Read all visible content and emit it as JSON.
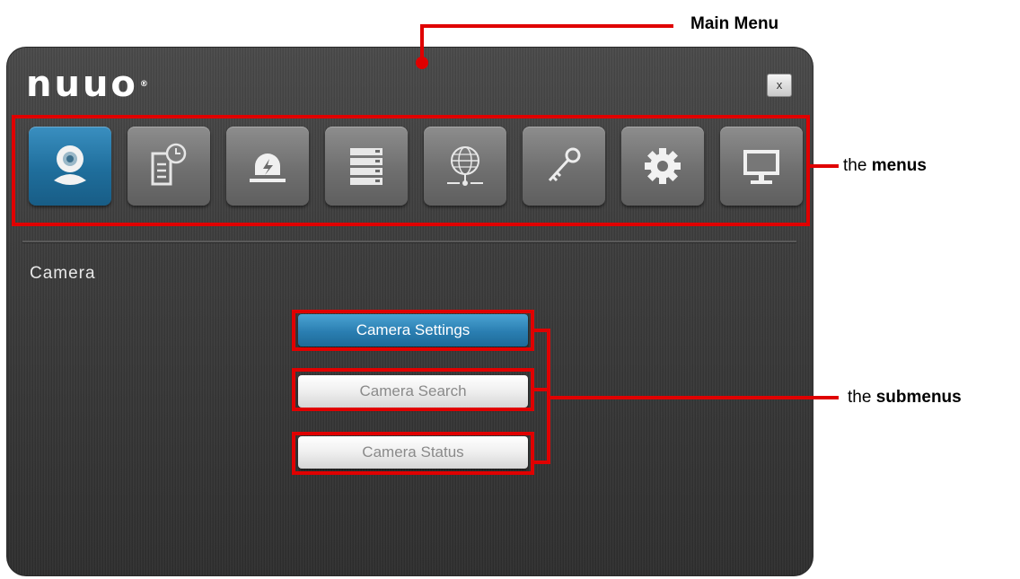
{
  "window": {
    "logo_text": "nuuo",
    "logo_mark": "®",
    "close_label": "x"
  },
  "menus": [
    {
      "name": "camera",
      "icon": "camera-icon",
      "active": true
    },
    {
      "name": "schedule",
      "icon": "schedule-document-icon",
      "active": false
    },
    {
      "name": "event",
      "icon": "alarm-siren-icon",
      "active": false
    },
    {
      "name": "storage",
      "icon": "storage-server-icon",
      "active": false
    },
    {
      "name": "network",
      "icon": "network-globe-icon",
      "active": false
    },
    {
      "name": "security",
      "icon": "key-icon",
      "active": false
    },
    {
      "name": "system",
      "icon": "gear-icon",
      "active": false
    },
    {
      "name": "display",
      "icon": "monitor-icon",
      "active": false
    }
  ],
  "section_title": "Camera",
  "submenus": [
    {
      "label": "Camera Settings",
      "active": true
    },
    {
      "label": "Camera Search",
      "active": false
    },
    {
      "label": "Camera Status",
      "active": false
    }
  ],
  "annotations": {
    "main_menu": "Main Menu",
    "menus_prefix": "the ",
    "menus_bold": "menus",
    "submenus_prefix": "the ",
    "submenus_bold": "submenus"
  },
  "colors": {
    "annotation": "#e00000",
    "accent_blue": "#2a7eb1",
    "window_bg": "#3c3c3c"
  }
}
